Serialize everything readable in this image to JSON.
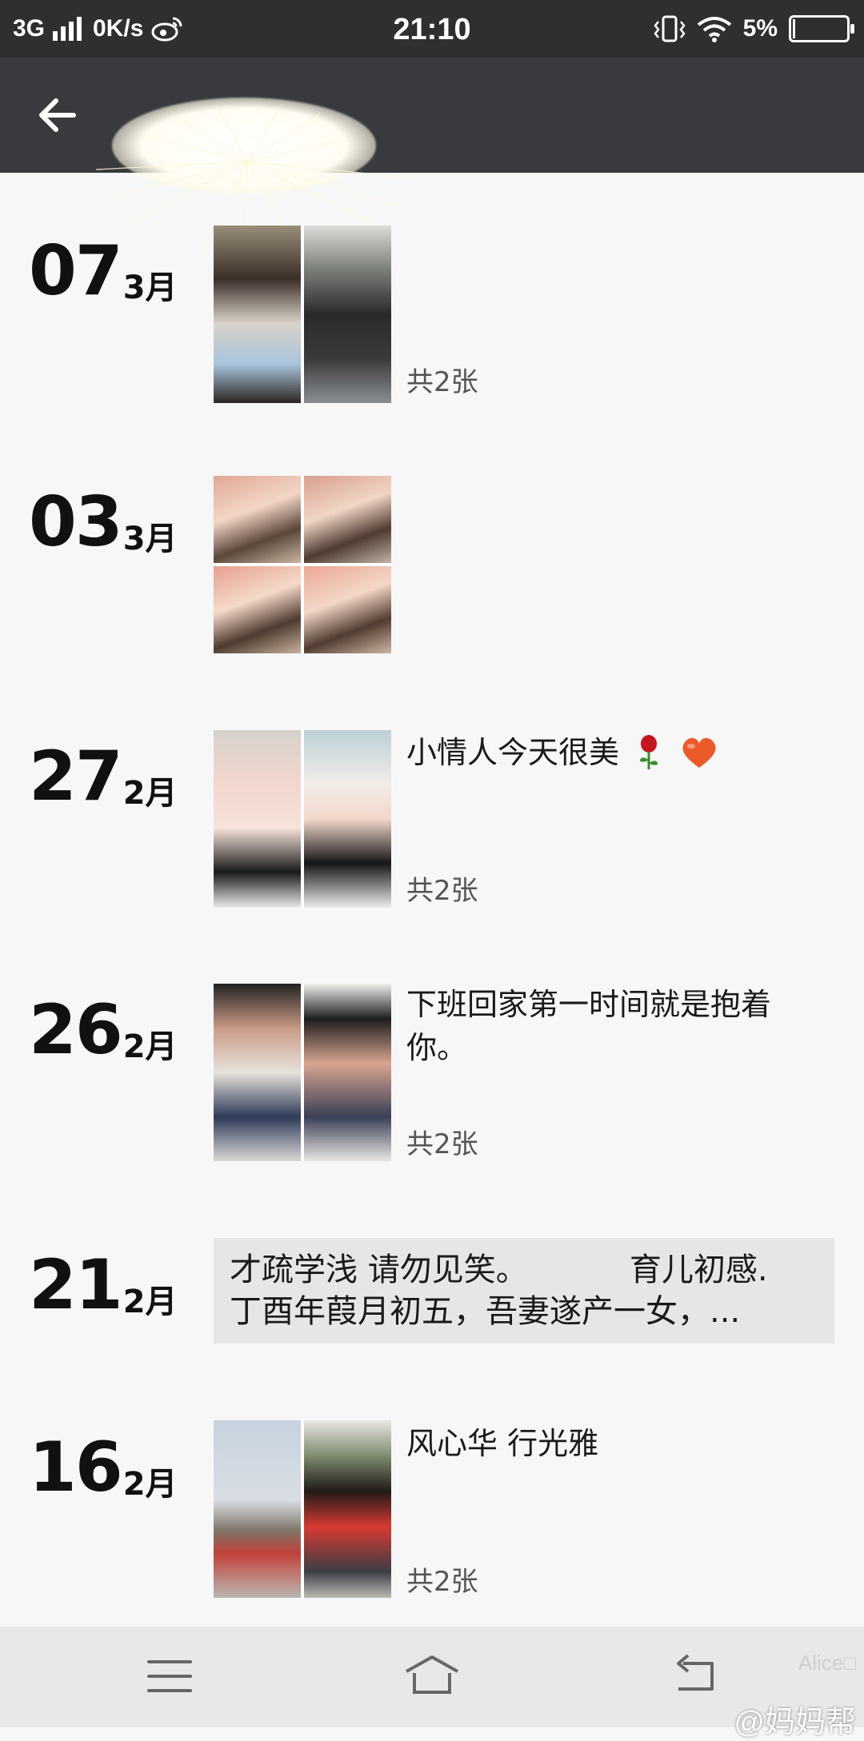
{
  "status_bar": {
    "network": "3G",
    "speed": "0K/s",
    "time": "21:10",
    "battery": "5%",
    "battery_level": 0.05
  },
  "toolbar": {
    "back_icon": "arrow-left-icon"
  },
  "entries": [
    {
      "day": "07",
      "month": "3月",
      "caption": "",
      "count": "共2张",
      "layout": "two"
    },
    {
      "day": "03",
      "month": "3月",
      "caption": "",
      "count": "",
      "layout": "four"
    },
    {
      "day": "27",
      "month": "2月",
      "caption": "小情人今天很美",
      "count": "共2张",
      "layout": "two",
      "emoji": [
        "rose-icon",
        "heart-icon"
      ]
    },
    {
      "day": "26",
      "month": "2月",
      "caption": "下班回家第一时间就是抱着你。",
      "count": "共2张",
      "layout": "two"
    },
    {
      "day": "21",
      "month": "2月",
      "text_card": {
        "line1": "才疏学浅 请勿见笑。          育儿初感.",
        "line2": "丁酉年葭月初五，吾妻遂产一女，..."
      }
    },
    {
      "day": "16",
      "month": "2月",
      "caption": "风心华 行光雅",
      "count": "共2张",
      "layout": "two"
    }
  ],
  "nav_bar": {
    "menu_icon": "menu-icon",
    "home_icon": "home-icon",
    "back_icon": "back-icon",
    "watermark": "@妈妈帮",
    "watermark_small": "Alice□"
  },
  "colors": {
    "status_bg": "#2f2f31",
    "toolbar_bg": "#393a3e",
    "page_bg": "#f7f7f7",
    "card_bg": "#e6e6e6"
  }
}
